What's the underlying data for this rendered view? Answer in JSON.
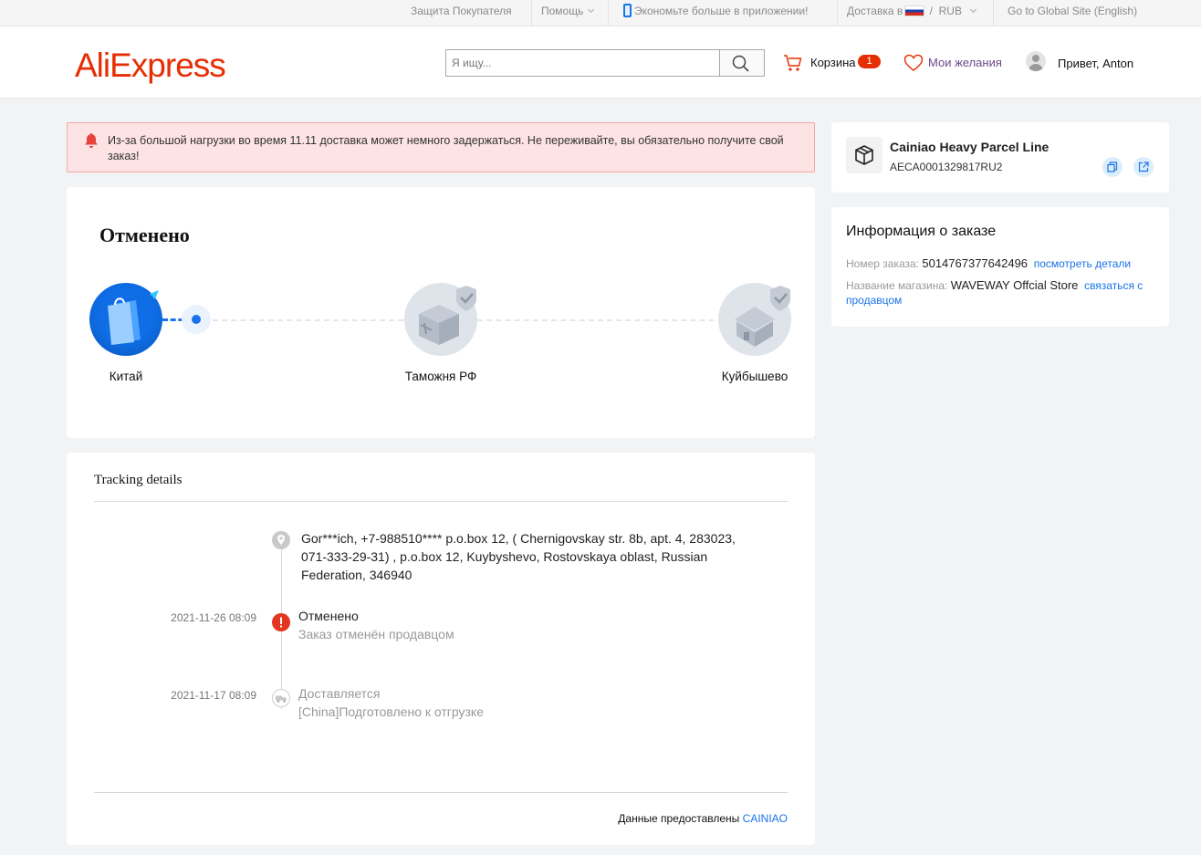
{
  "topbar": {
    "buyer_protection": "Защита Покупателя",
    "help": "Помощь",
    "app_promo": "Экономьте больше в приложении!",
    "shipping_to": "Доставка в",
    "currency_sep": "/",
    "currency": "RUB",
    "global_site": "Go to Global Site (English)"
  },
  "header": {
    "logo": "AliExpress",
    "search_placeholder": "Я ищу...",
    "cart_label": "Корзина",
    "cart_count": "1",
    "wishlist_label": "Мои желания",
    "greeting": "Привет, Anton"
  },
  "notice": {
    "text": "Из-за большой нагрузки во время 11.11 доставка может немного задержаться. Не переживайте, вы обязательно получите свой заказ!"
  },
  "status": {
    "title": "Отменено",
    "stages": [
      {
        "label": "Китай",
        "state": "active",
        "icon": "shopping-bag-icon"
      },
      {
        "label": "Таможня РФ",
        "state": "pending",
        "icon": "customs-box-icon"
      },
      {
        "label": "Куйбышево",
        "state": "pending",
        "icon": "house-icon"
      }
    ],
    "colors": {
      "active": "#0f6de6",
      "pending": "#dfe4ea"
    }
  },
  "tracking": {
    "title": "Tracking details",
    "address": "Gor***ich,  +7-988510****  p.o.box 12, ( Chernigovskay str. 8b, apt. 4, 283023, 071-333-29-31) , p.o.box 12,  Kuybyshevo,  Rostovskaya oblast,  Russian Federation,  346940",
    "events": [
      {
        "time": "2021-11-26 08:09",
        "title": "Отменено",
        "desc": "Заказ отменён продавцом",
        "icon": "alert-icon"
      },
      {
        "time": "2021-11-17 08:09",
        "title": "Доставляется",
        "desc": "[China]Подготовлено к отгрузке",
        "icon": "truck-icon"
      }
    ],
    "provider_label": "Данные предоставлены",
    "provider_name": "CAINIAO"
  },
  "carrier": {
    "name": "Cainiao Heavy Parcel Line",
    "tracking_number": "AECA0001329817RU2"
  },
  "order_info": {
    "title": "Информация о заказе",
    "order_number_label": "Номер заказа:",
    "order_number": "5014767377642496",
    "details_link": "посмотреть детали",
    "store_label": "Название магазина:",
    "store_name": "WAVEWAY Offcial Store",
    "contact_link": "связаться с продавцом"
  },
  "accent_colors": {
    "brand": "#e62e04",
    "link": "#1a73e8",
    "notice_bg": "#fde3e3"
  }
}
